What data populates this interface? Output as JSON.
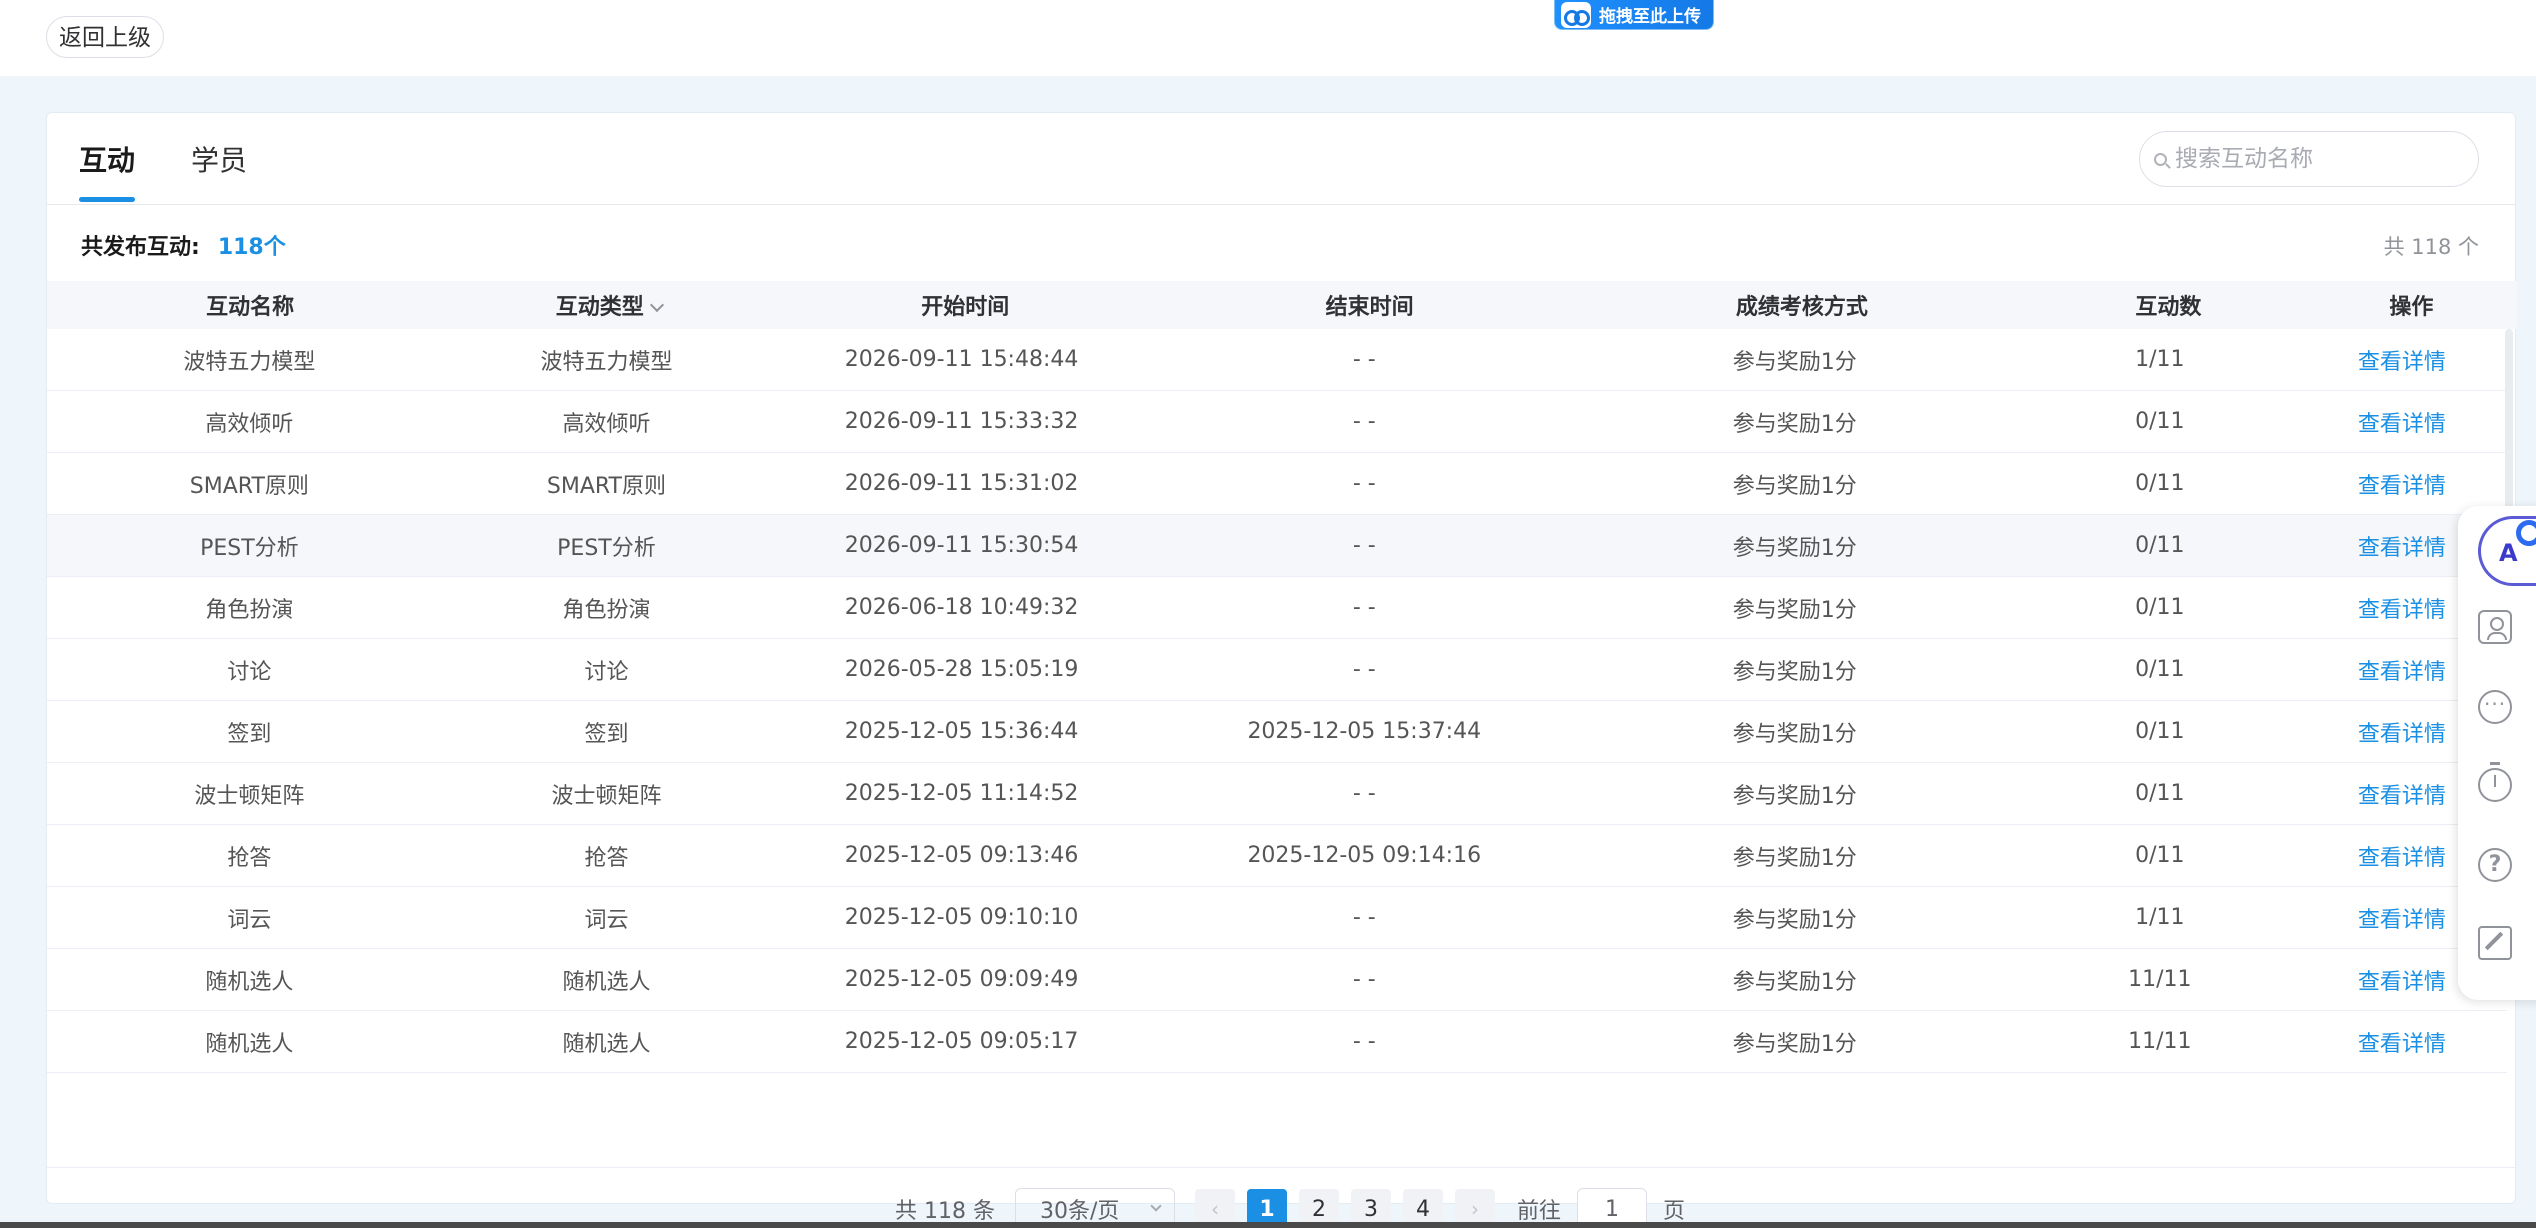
{
  "topbar": {
    "back_label": "返回上级",
    "upload_label": "拖拽至此上传"
  },
  "tabs": [
    {
      "label": "互动",
      "active": true
    },
    {
      "label": "学员",
      "active": false
    }
  ],
  "search": {
    "placeholder": "搜索互动名称"
  },
  "summary": {
    "label": "共发布互动:",
    "count": "118个",
    "total_right": "共 118 个"
  },
  "table": {
    "columns": [
      "互动名称",
      "互动类型",
      "开始时间",
      "结束时间",
      "成绩考核方式",
      "互动数",
      "操作"
    ],
    "action_label": "查看详情",
    "rows": [
      {
        "name": "波特五力模型",
        "type": "波特五力模型",
        "start": "2026-09-11 15:48:44",
        "end": "- -",
        "scoring": "参与奖励1分",
        "count": "1/11"
      },
      {
        "name": "高效倾听",
        "type": "高效倾听",
        "start": "2026-09-11 15:33:32",
        "end": "- -",
        "scoring": "参与奖励1分",
        "count": "0/11"
      },
      {
        "name": "SMART原则",
        "type": "SMART原则",
        "start": "2026-09-11 15:31:02",
        "end": "- -",
        "scoring": "参与奖励1分",
        "count": "0/11"
      },
      {
        "name": "PEST分析",
        "type": "PEST分析",
        "start": "2026-09-11 15:30:54",
        "end": "- -",
        "scoring": "参与奖励1分",
        "count": "0/11"
      },
      {
        "name": "角色扮演",
        "type": "角色扮演",
        "start": "2026-06-18 10:49:32",
        "end": "- -",
        "scoring": "参与奖励1分",
        "count": "0/11"
      },
      {
        "name": "讨论",
        "type": "讨论",
        "start": "2026-05-28 15:05:19",
        "end": "- -",
        "scoring": "参与奖励1分",
        "count": "0/11"
      },
      {
        "name": "签到",
        "type": "签到",
        "start": "2025-12-05 15:36:44",
        "end": "2025-12-05 15:37:44",
        "scoring": "参与奖励1分",
        "count": "0/11"
      },
      {
        "name": "波士顿矩阵",
        "type": "波士顿矩阵",
        "start": "2025-12-05 11:14:52",
        "end": "- -",
        "scoring": "参与奖励1分",
        "count": "0/11"
      },
      {
        "name": "抢答",
        "type": "抢答",
        "start": "2025-12-05 09:13:46",
        "end": "2025-12-05 09:14:16",
        "scoring": "参与奖励1分",
        "count": "0/11"
      },
      {
        "name": "词云",
        "type": "词云",
        "start": "2025-12-05 09:10:10",
        "end": "- -",
        "scoring": "参与奖励1分",
        "count": "1/11"
      },
      {
        "name": "随机选人",
        "type": "随机选人",
        "start": "2025-12-05 09:09:49",
        "end": "- -",
        "scoring": "参与奖励1分",
        "count": "11/11"
      },
      {
        "name": "随机选人",
        "type": "随机选人",
        "start": "2025-12-05 09:05:17",
        "end": "- -",
        "scoring": "参与奖励1分",
        "count": "11/11"
      }
    ]
  },
  "pagination": {
    "total": "共 118 条",
    "page_size": "30条/页",
    "prev": "‹",
    "next": "›",
    "pages": [
      "1",
      "2",
      "3",
      "4"
    ],
    "current": "1",
    "goto_label": "前往",
    "goto_value": "1",
    "page_suffix": "页"
  },
  "side_tools": {
    "ai_label": "A",
    "help_label": "?"
  },
  "colors": {
    "accent": "#1a8fe3",
    "background": "#eef6fc"
  }
}
